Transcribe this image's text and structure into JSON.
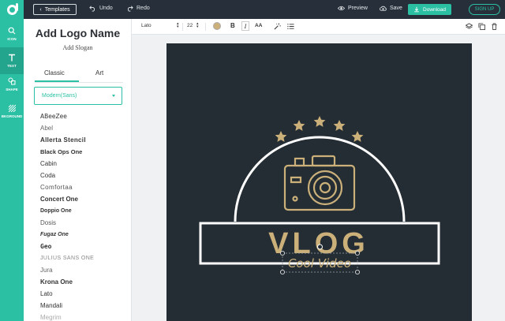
{
  "topbar": {
    "templates_label": "Templates",
    "undo_label": "Undo",
    "redo_label": "Redo",
    "preview_label": "Preview",
    "save_label": "Save",
    "download_label": "Download",
    "signup_label": "SIGN UP"
  },
  "rail": {
    "items": [
      {
        "label": "ICON"
      },
      {
        "label": "TEXT"
      },
      {
        "label": "SHAPE"
      },
      {
        "label": "BKGROUND"
      }
    ]
  },
  "panel": {
    "title": "Add Logo Name",
    "slogan": "Add Slogan",
    "tabs": [
      "Classic",
      "Art"
    ],
    "selected_font": "Modern(Sans)",
    "fonts": [
      "ABeeZee",
      "Abel",
      "Allerta Stencil",
      "Black Ops One",
      "Cabin",
      "Coda",
      "Comfortaa",
      "Concert One",
      "Doppio One",
      "Dosis",
      "Fugaz One",
      "Geo",
      "JULIUS SANS ONE",
      "Jura",
      "Krona One",
      "Lato",
      "Mandali",
      "Megrim"
    ]
  },
  "format_toolbar": {
    "font_family": "Lato",
    "font_size": "22",
    "color": "#cbb07a",
    "bold": "B",
    "italic": "I",
    "case": "AA"
  },
  "canvas": {
    "background": "#242d34",
    "accent": "#cbb07a",
    "title": "VLOG",
    "subtitle": "Cool Video"
  },
  "colors": {
    "brand": "#2bc0a4",
    "topbar": "#27303a"
  }
}
